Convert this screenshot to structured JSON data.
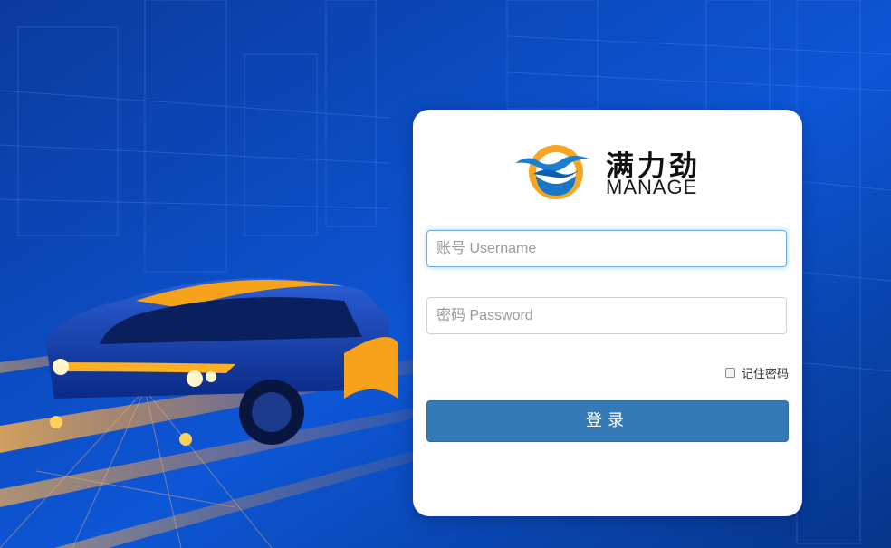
{
  "brand": {
    "name_cn": "满力劲",
    "name_en": "MANAGE"
  },
  "login": {
    "username_placeholder": "账号 Username",
    "username_value": "",
    "password_placeholder": "密码 Password",
    "password_value": "",
    "remember_label": "记住密码",
    "remember_checked": false,
    "submit_label": "登录"
  },
  "colors": {
    "background": "#0a3fae",
    "card": "#ffffff",
    "button": "#337ab7",
    "logo_ring": "#f5a623",
    "logo_blue": "#1877c8"
  }
}
